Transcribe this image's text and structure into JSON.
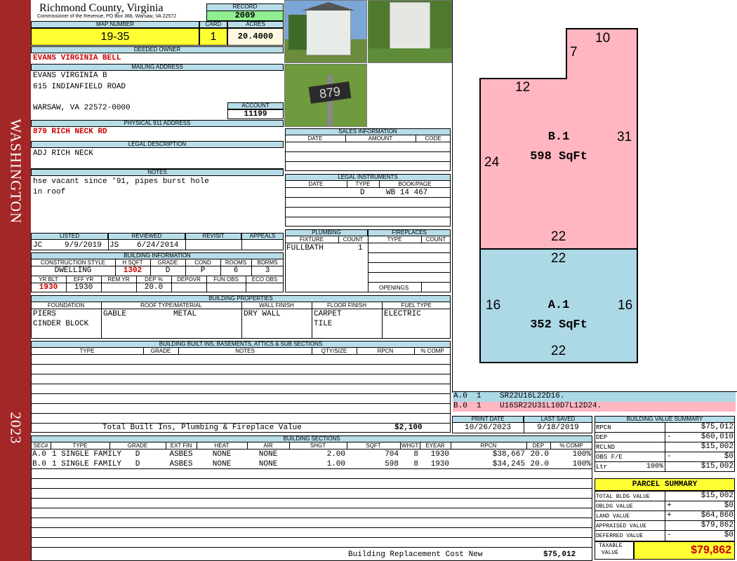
{
  "sidebar": {
    "name": "WASHINGTON",
    "year": "2023",
    "color": "#a32727"
  },
  "header": {
    "county": "Richmond County, Virginia",
    "commissioner": "Commissioner of the Revenue, PO Box 366, Warsaw, VA 22572",
    "record_label": "RECORD",
    "record": "2009",
    "map_label": "MAP NUMBER",
    "map": "19-35",
    "card_label": "CARD",
    "card": "1",
    "acres_label": "ACRES",
    "acres": "20.4000"
  },
  "owner": {
    "label": "DEEDED OWNER",
    "name": "EVANS VIRGINIA BELL"
  },
  "mailing": {
    "label": "MAILING ADDRESS",
    "line1": "EVANS VIRGINIA B",
    "line2": "615 INDIANFIELD ROAD",
    "line3": "WARSAW, VA 22572-0000",
    "account_label": "ACCOUNT",
    "account": "11199"
  },
  "physical": {
    "label": "PHYSICAL 911 ADDRESS",
    "value": "879 RICH NECK RD"
  },
  "legal": {
    "label": "LEGAL DESCRIPTION",
    "value": "ADJ RICH NECK"
  },
  "notes": {
    "label": "NOTES",
    "line1": "hse vacant since '91, pipes burst hole",
    "line2": "in roof"
  },
  "review": {
    "listed_label": "LISTED",
    "reviewed_label": "REVIEWED",
    "revisit_label": "REVISIT",
    "appeals_label": "APPEALS",
    "listed_by": "JC",
    "listed_date": "9/9/2019",
    "reviewed_by": "JS",
    "reviewed_date": "6/24/2014"
  },
  "building_info": {
    "label": "BUILDING INFORMATION",
    "h_construction": "CONSTRUCTION STYLE",
    "h_hsqft": "H SQFT",
    "h_grade": "GRADE",
    "h_cond": "COND",
    "h_rooms": "ROOMS",
    "h_bdrms": "BDRMS",
    "construction": "DWELLING",
    "hsqft": "1302",
    "grade": "D",
    "cond": "P",
    "rooms": "6",
    "bdrms": "3",
    "h_yrblt": "YR BLT",
    "h_effyr": "EFF YR",
    "h_remyr": "REM YR",
    "h_dep": "DEP %",
    "h_depovr": "DEPOVR",
    "h_funobs": "FUN OBS",
    "h_ecoobs": "ECO OBS",
    "yrblt": "1930",
    "effyr": "1930",
    "dep": "20.0"
  },
  "sales": {
    "label": "SALES INFORMATION",
    "h_date": "DATE",
    "h_amount": "AMOUNT",
    "h_code": "CODE"
  },
  "legal_instruments": {
    "label": "LEGAL INSTRUMENTS",
    "h_date": "DATE",
    "h_type": "TYPE",
    "h_book": "BOOK/PAGE",
    "type": "D",
    "book": "WB 14 467"
  },
  "plumbing": {
    "label": "PLUMBING",
    "h_fixture": "FIXTURE",
    "h_count": "COUNT",
    "fixture": "FULLBATH",
    "count": "1"
  },
  "fireplaces": {
    "label": "FIREPLACES",
    "h_type": "TYPE",
    "h_count": "COUNT",
    "openings": "OPENINGS"
  },
  "properties": {
    "label": "BUILDING PROPERTIES",
    "h_foundation": "FOUNDATION",
    "h_roof": "ROOF TYPE/MATERIAL",
    "h_wall": "WALL FINISH",
    "h_floor": "FLOOR FINISH",
    "h_fuel": "FUEL TYPE",
    "foundation1": "PIERS",
    "foundation2": "CINDER BLOCK",
    "roof_type": "GABLE",
    "roof_mat": "METAL",
    "wall": "DRY WALL",
    "floor1": "CARPET",
    "floor2": "TILE",
    "fuel": "ELECTRIC"
  },
  "builtins": {
    "label": "BUILDING BUILT INS, BASEMENTS, ATTICS & SUB SECTIONS",
    "h_type": "TYPE",
    "h_grade": "GRADE",
    "h_notes": "NOTES",
    "h_qty": "QTY/SIZE",
    "h_rpcn": "RPCN",
    "h_comp": "% COMP",
    "total_label": "Total Built Ins, Plumbing & Fireplace Value",
    "total": "$2,100"
  },
  "dates": {
    "print_label": "PRINT DATE",
    "saved_label": "LAST SAVED",
    "print": "10/26/2023",
    "saved": "9/18/2019"
  },
  "sketch": {
    "B": {
      "label": "B.1",
      "area": "598 SqFt",
      "color": "#ffb6c1"
    },
    "A": {
      "label": "A.1",
      "area": "352 SqFt",
      "color": "#add8e6"
    },
    "dims": {
      "top": "10",
      "notch": "7",
      "mid": "12",
      "right": "31",
      "left": "24",
      "b_bottom": "22",
      "a_top": "22",
      "a_left": "16",
      "a_right": "16",
      "a_bottom": "22"
    },
    "legend_a": "A.0  1    SR22U16L22D16.",
    "legend_b": "B.0  1    U16SR22U31L10D7L12D24."
  },
  "sections": {
    "label": "BUILDING SECTIONS",
    "headers": [
      "SEC#",
      "TYPE",
      "GRADE",
      "EXT FIN",
      "HEAT",
      "AIR",
      "SHGT",
      "SQFT",
      "WHGT",
      "EYEAR",
      "RPCN",
      "DEP",
      "% COMP"
    ],
    "rows": [
      [
        "A.0",
        "1 SINGLE FAMILY",
        "D",
        "ASBES",
        "NONE",
        "NONE",
        "2.00",
        "704",
        "8",
        "1930",
        "$38,667",
        "20.0",
        "100%"
      ],
      [
        "B.0",
        "1 SINGLE FAMILY",
        "D",
        "ASBES",
        "NONE",
        "NONE",
        "1.00",
        "598",
        "8",
        "1930",
        "$34,245",
        "20.0",
        "100%"
      ]
    ],
    "replacement_label": "Building Replacement Cost New",
    "replacement": "$75,012"
  },
  "value_summary": {
    "label": "BUILDING VALUE SUMMARY",
    "rpcn_label": "RPCN",
    "rpcn": "$75,012",
    "dep_label": "DEP",
    "dep_sign": "-",
    "dep": "$60,010",
    "rclnd_label": "RCLND",
    "rclnd": "$15,002",
    "obs_label": "OBS F/E",
    "obs_sign": "-",
    "obs": "$0",
    "ltr_label": "Ltr",
    "ltr_pct": "100%",
    "ltr": "$15,002"
  },
  "parcel": {
    "label": "PARCEL SUMMARY",
    "total_bldg_label": "TOTAL BLDG VALUE",
    "total_bldg": "$15,002",
    "obldg_label": "OBLDG VALUE",
    "obldg_sign": "+",
    "obldg": "$0",
    "land_label": "LAND VALUE",
    "land_sign": "+",
    "land": "$64,860",
    "appraised_label": "APPRAISED VALUE",
    "appraised": "$79,862",
    "deferred_label": "DEFERRED VALUE",
    "deferred_sign": "-",
    "deferred": "$0",
    "taxable_label1": "TAXABLE",
    "taxable_label2": "VALUE",
    "taxable": "$79,862"
  },
  "photos": {
    "sign": "879"
  }
}
